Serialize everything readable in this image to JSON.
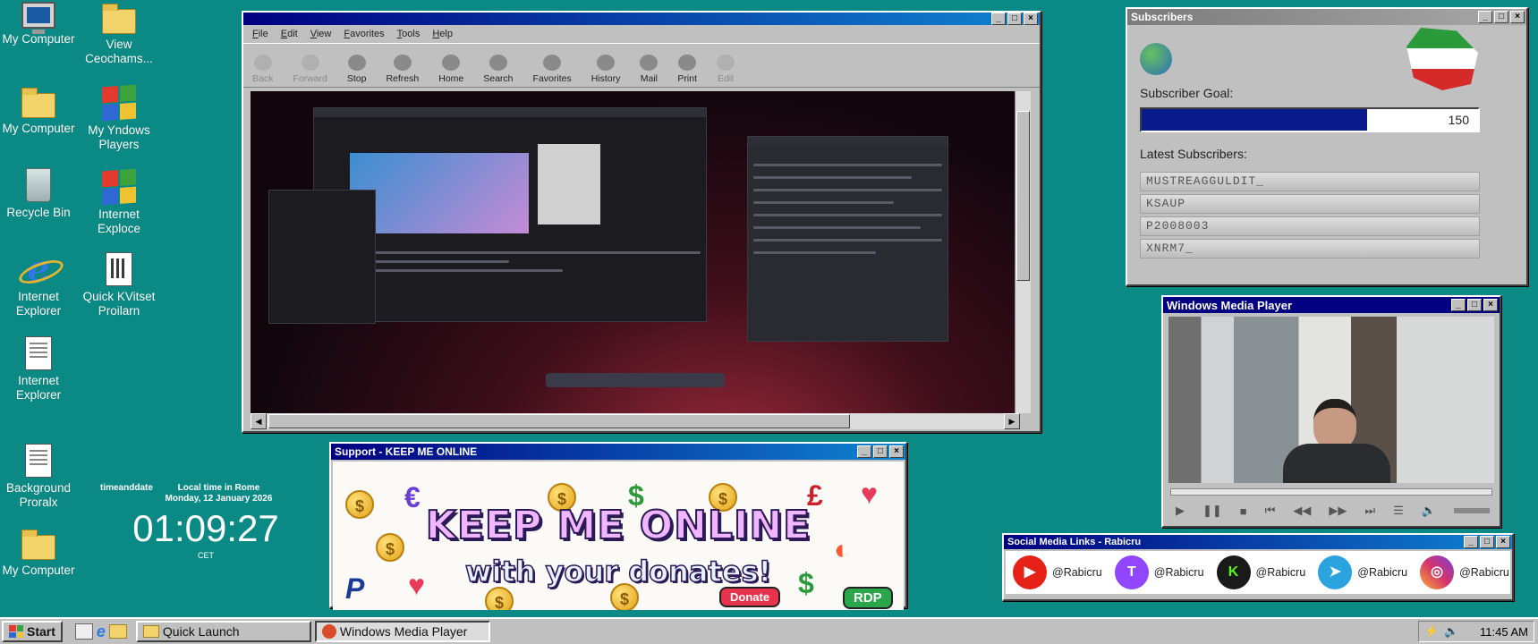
{
  "desktop": {
    "icons": [
      {
        "label": "My Computer",
        "icon": "computer-icon"
      },
      {
        "label": "View Ceochams...",
        "icon": "folder-icon"
      },
      {
        "label": "My Computer",
        "icon": "folder-documents-icon"
      },
      {
        "label": "My Yndows Players",
        "icon": "windows-logo-icon"
      },
      {
        "label": "Recycle Bin",
        "icon": "recycle-bin-icon"
      },
      {
        "label": "Internet Exploce",
        "icon": "windows-logo-icon"
      },
      {
        "label": "Internet Explorer",
        "icon": "internet-explorer-icon"
      },
      {
        "label": "Quick KVitset Proilarn",
        "icon": "spreadsheet-icon"
      },
      {
        "label": "Internet Explorer",
        "icon": "document-icon"
      },
      {
        "label": "Background Proralx",
        "icon": "window-icon"
      },
      {
        "label": "My Computer",
        "icon": "folder-icon"
      }
    ]
  },
  "clock": {
    "brand": "timeanddate",
    "caption_line1": "Local time in Rome",
    "caption_line2": "Monday, 12 January 2026",
    "time": "01:09:27",
    "zone": "CET"
  },
  "ie": {
    "menu": [
      "File",
      "Edit",
      "View",
      "Favorites",
      "Tools",
      "Help"
    ],
    "toolbar": [
      {
        "label": "Back",
        "enabled": false
      },
      {
        "label": "Forward",
        "enabled": false
      },
      {
        "label": "Stop",
        "enabled": true
      },
      {
        "label": "Refresh",
        "enabled": true
      },
      {
        "label": "Home",
        "enabled": true
      },
      {
        "label": "Search",
        "enabled": true
      },
      {
        "label": "Favorites",
        "enabled": true
      },
      {
        "label": "History",
        "enabled": true
      },
      {
        "label": "Mail",
        "enabled": true
      },
      {
        "label": "Print",
        "enabled": true
      },
      {
        "label": "Edit",
        "enabled": false
      }
    ]
  },
  "subscribers": {
    "title": "Subscribers",
    "goal_label": "Subscriber Goal:",
    "goal_value": "150",
    "goal_progress": 0.67,
    "latest_label": "Latest Subscribers:",
    "latest": [
      "MUSTREAGGULDIT_",
      "KSAUP",
      "P2008003",
      "XNRM7_"
    ]
  },
  "wmp": {
    "title": "Windows Media Player"
  },
  "support": {
    "title": "Support - KEEP ME ONLINE",
    "headline": "KEEP ME ONLINE",
    "subline": "with your donates!",
    "donate": "Donate",
    "rdp": "RDP"
  },
  "social": {
    "title": "Social Media Links - Rabicru",
    "links": [
      {
        "handle": "@Rabicru",
        "icon": "youtube-icon",
        "color": "#e62117",
        "glyph": "▶"
      },
      {
        "handle": "@Rabicru",
        "icon": "twitch-icon",
        "color": "#9146ff",
        "glyph": "T"
      },
      {
        "handle": "@Rabicru",
        "icon": "kick-icon",
        "color": "#1a1a1a",
        "glyph": "K"
      },
      {
        "handle": "@Rabicru",
        "icon": "telegram-icon",
        "color": "#2aa3df",
        "glyph": "➤"
      },
      {
        "handle": "@Rabicru",
        "icon": "instagram-icon",
        "color": "#d6336c",
        "glyph": "◎"
      }
    ]
  },
  "taskbar": {
    "start": "Start",
    "tasks": [
      "Quick Launch",
      "Windows Media Player"
    ],
    "time": "11:45 AM"
  },
  "colors": {
    "desktop": "#0b8a85",
    "title_active": "#000080",
    "goal_fill": "#0a1c8c"
  }
}
